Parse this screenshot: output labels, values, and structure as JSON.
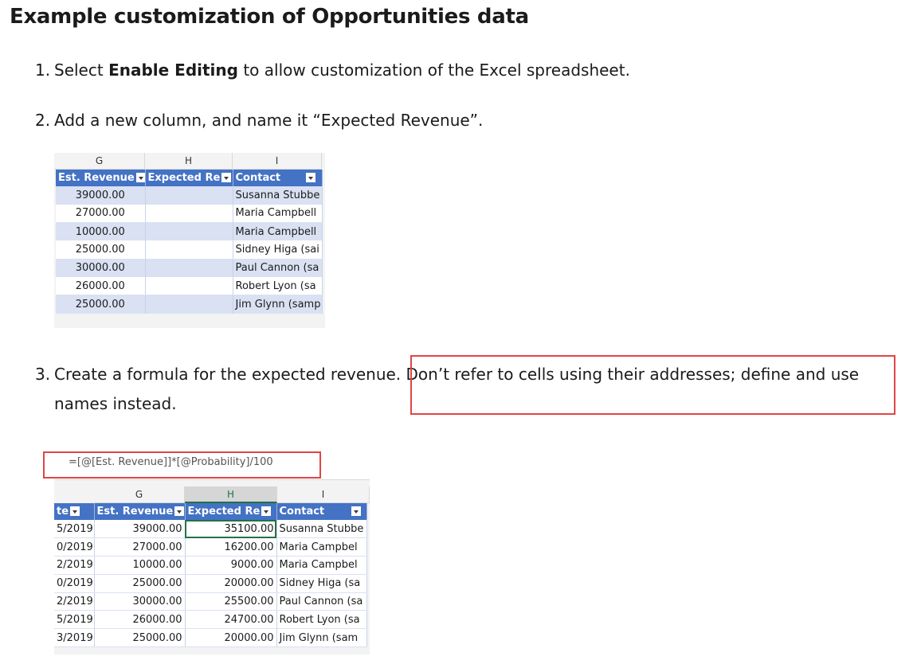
{
  "title": "Example customization of Opportunities data",
  "steps": {
    "s1": {
      "num": "1.",
      "pre": "Select ",
      "bold": "Enable Editing",
      "post": " to allow customization of the Excel spreadsheet."
    },
    "s2": {
      "num": "2.",
      "text": "Add a new column, and name it “Expected Revenue”."
    },
    "s3": {
      "num": "3.",
      "line1": "Create a formula for the expected revenue. Don’t refer to cells using their addresses; define and use",
      "line2": "names instead."
    }
  },
  "sheet1": {
    "columns": [
      "G",
      "H",
      "I"
    ],
    "headers": [
      "Est. Revenue",
      "Expected Re",
      "Contact"
    ],
    "rows": [
      {
        "est": "39000.00",
        "contact": "Susanna Stubbe"
      },
      {
        "est": "27000.00",
        "contact": "Maria Campbell"
      },
      {
        "est": "10000.00",
        "contact": "Maria Campbell"
      },
      {
        "est": "25000.00",
        "contact": "Sidney Higa (sai"
      },
      {
        "est": "30000.00",
        "contact": "Paul Cannon (sa"
      },
      {
        "est": "26000.00",
        "contact": "Robert Lyon (sa"
      },
      {
        "est": "25000.00",
        "contact": "Jim Glynn (samp"
      }
    ]
  },
  "sheet2": {
    "formula": "=[@[Est. Revenue]]*[@Probability]/100",
    "columns": [
      "G",
      "H",
      "I"
    ],
    "headers": [
      "te",
      "Est. Revenue",
      "Expected Re",
      "Contact"
    ],
    "rows": [
      {
        "date": "5/2019",
        "est": "39000.00",
        "exp": "35100.00",
        "contact": "Susanna Stubbe"
      },
      {
        "date": "0/2019",
        "est": "27000.00",
        "exp": "16200.00",
        "contact": "Maria Campbel"
      },
      {
        "date": "2/2019",
        "est": "10000.00",
        "exp": "9000.00",
        "contact": "Maria Campbel"
      },
      {
        "date": "0/2019",
        "est": "25000.00",
        "exp": "20000.00",
        "contact": "Sidney Higa (sa"
      },
      {
        "date": "2/2019",
        "est": "30000.00",
        "exp": "25500.00",
        "contact": "Paul Cannon (sa"
      },
      {
        "date": "5/2019",
        "est": "26000.00",
        "exp": "24700.00",
        "contact": "Robert Lyon (sa"
      },
      {
        "date": "3/2019",
        "est": "25000.00",
        "exp": "20000.00",
        "contact": "Jim Glynn (sam"
      }
    ]
  },
  "colors": {
    "table_header": "#4472c4",
    "band": "#d9e1f2",
    "highlight": "#e04545",
    "excel_green": "#217346"
  }
}
